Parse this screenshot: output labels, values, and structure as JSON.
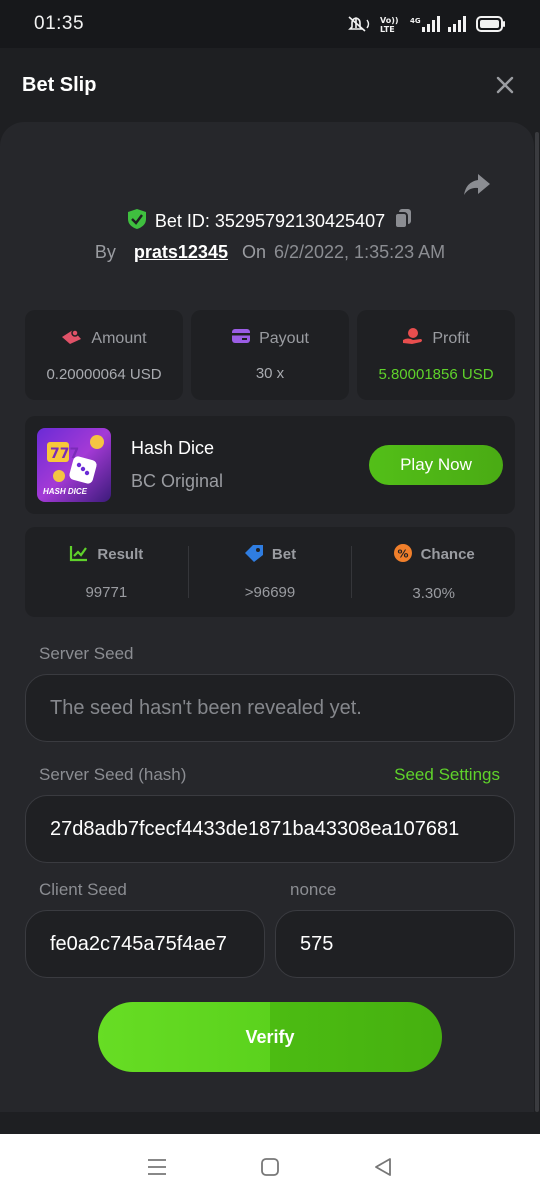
{
  "status": {
    "time": "01:35",
    "network": "4G",
    "volte": "VoLTE"
  },
  "header": {
    "title": "Bet Slip"
  },
  "bet": {
    "id_label": "Bet ID: 35295792130425407",
    "by_label": "By",
    "user": "prats12345",
    "on_label": "On",
    "date": "6/2/2022, 1:35:23 AM"
  },
  "stats": [
    {
      "label": "Amount",
      "value": "0.20000064 USD",
      "icon": "money-icon",
      "color": "#e05268"
    },
    {
      "label": "Payout",
      "value": "30 x",
      "icon": "card-icon",
      "color": "#9b5de5"
    },
    {
      "label": "Profit",
      "value": "5.80001856 USD",
      "icon": "hand-coin-icon",
      "color": "#e84e4e",
      "value_color": "#5fd22b"
    }
  ],
  "game": {
    "name": "Hash Dice",
    "subtitle": "BC Original",
    "thumb_label": "HASH DICE",
    "play_label": "Play Now"
  },
  "result": [
    {
      "label": "Result",
      "value": "99771",
      "icon": "chart-check-icon",
      "color": "#5fd22b"
    },
    {
      "label": "Bet",
      "value": ">96699",
      "icon": "tag-icon",
      "color": "#2f7de1"
    },
    {
      "label": "Chance",
      "value": "3.30%",
      "icon": "percent-icon",
      "color": "#f07f2b"
    }
  ],
  "form": {
    "server_seed_label": "Server Seed",
    "server_seed_value": "The seed hasn't been revealed yet.",
    "server_seed_hash_label": "Server Seed (hash)",
    "seed_settings_label": "Seed Settings",
    "server_seed_hash_value": "27d8adb7fcecf4433de1871ba43308ea107681",
    "client_seed_label": "Client Seed",
    "client_seed_value": "fe0a2c745a75f4ae7",
    "nonce_label": "nonce",
    "nonce_value": "575",
    "verify_label": "Verify"
  }
}
